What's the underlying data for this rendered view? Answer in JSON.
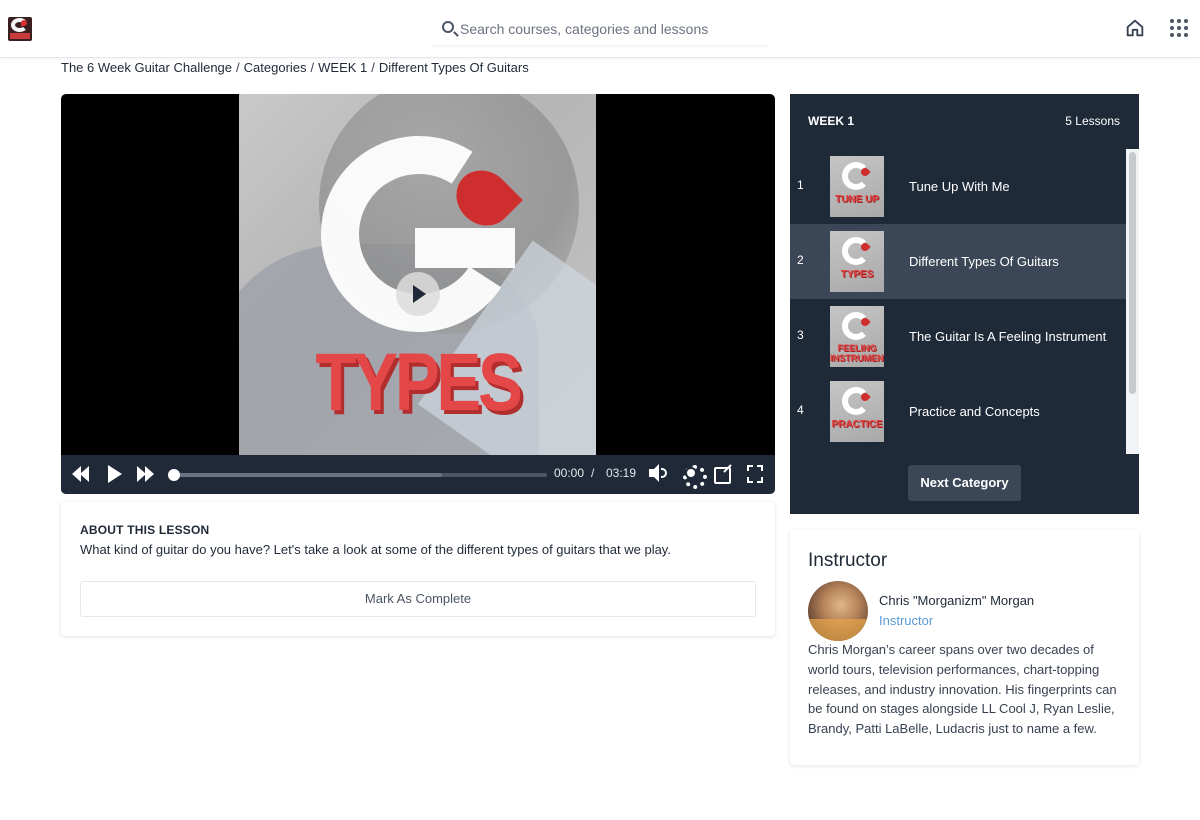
{
  "search": {
    "placeholder": "Search courses, categories and lessons"
  },
  "breadcrumb": [
    "The 6 Week Guitar Challenge",
    "Categories",
    "WEEK 1",
    "Different Types Of Guitars"
  ],
  "breadcrumb_separator": "/",
  "video": {
    "thumbnail_word": "TYPES",
    "current_time": "00:00",
    "time_separator": "/",
    "duration": "03:19",
    "progress": 0.0,
    "buffered": 0.72
  },
  "about": {
    "heading": "ABOUT THIS LESSON",
    "text": "What kind of guitar do you have? Let's take a look at some of the different types of guitars that we play.",
    "mark_complete_label": "Mark As Complete"
  },
  "lessons_panel": {
    "week": "WEEK 1",
    "count": "5 Lessons",
    "items": [
      {
        "num": "1",
        "title": "Tune Up With Me",
        "thumb_text": "TUNE UP",
        "active": false
      },
      {
        "num": "2",
        "title": "Different Types Of Guitars",
        "thumb_text": "TYPES",
        "active": true
      },
      {
        "num": "3",
        "title": "The Guitar Is A Feeling Instrument",
        "thumb_text": "FEELING INSTRUMENT",
        "active": false
      },
      {
        "num": "4",
        "title": "Practice and Concepts",
        "thumb_text": "PRACTICE",
        "active": false
      }
    ],
    "next_label": "Next Category"
  },
  "instructor": {
    "heading": "Instructor",
    "name": "Chris \"Morganizm\" Morgan",
    "role": "Instructor",
    "bio": "Chris Morgan’s career spans over two decades of world tours, television performances, chart-topping releases, and industry innovation. His fingerprints can be found on stages alongside LL Cool J, Ryan Leslie, Brandy, Patti LaBelle, Ludacris just to name a few."
  },
  "colors": {
    "panel_bg": "#1f2a38",
    "active_row": "#3b4656",
    "accent_link": "#5a9ad6",
    "brand_red": "#e24444"
  },
  "icons": {
    "logo": "site-logo",
    "search": "search-icon",
    "home": "home-icon",
    "apps": "grid-icon"
  }
}
